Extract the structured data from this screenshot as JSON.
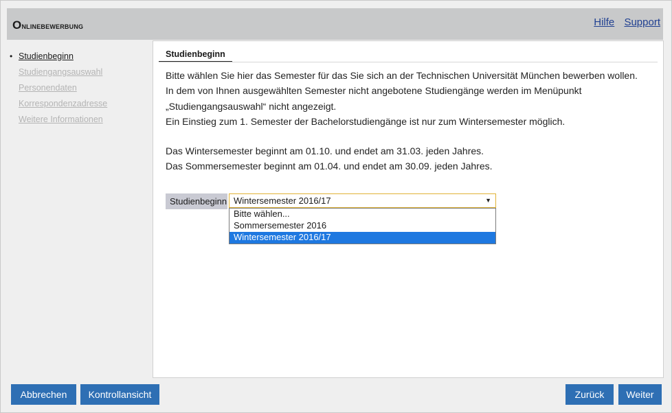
{
  "header": {
    "title_first": "O",
    "title_rest": "nlinebewerbung",
    "links": [
      "Hilfe",
      "Support"
    ]
  },
  "sidebar": {
    "items": [
      {
        "label": "Studienbeginn",
        "state": "active"
      },
      {
        "label": "Studiengangsauswahl",
        "state": "disabled"
      },
      {
        "label": "Personendaten",
        "state": "disabled"
      },
      {
        "label": "Korrespondenzadresse",
        "state": "disabled"
      },
      {
        "label": "Weitere Informationen",
        "state": "disabled"
      }
    ]
  },
  "main": {
    "tab": "Studienbeginn",
    "paragraphs": [
      "Bitte wählen Sie hier das Semester für das Sie sich an der Technischen Universität München bewerben wollen.",
      "In dem von Ihnen ausgewählten Semester nicht angebotene Studiengänge werden im Menüpunkt",
      "„Studiengangsauswahl“ nicht angezeigt.",
      "Ein Einstieg zum 1. Semester der Bachelorstudiengänge ist nur zum Wintersemester möglich.",
      "Das Wintersemester beginnt am 01.10. und endet am 31.03. jeden Jahres.",
      "Das Sommersemester beginnt am 01.04. und endet am 30.09. jeden Jahres."
    ],
    "field": {
      "label": "Studienbeginn",
      "value": "Wintersemester 2016/17",
      "options": [
        "Bitte wählen...",
        "Sommersemester 2016",
        "Wintersemester 2016/17"
      ],
      "highlighted": "Wintersemester 2016/17"
    }
  },
  "footer": {
    "cancel": "Abbrechen",
    "control": "Kontrollansicht",
    "back": "Zurück",
    "next": "Weiter"
  },
  "colors": {
    "button": "#2e6fb4",
    "header": "#c8c9ca",
    "link": "#1f3f91",
    "highlight": "#1e78e0"
  }
}
